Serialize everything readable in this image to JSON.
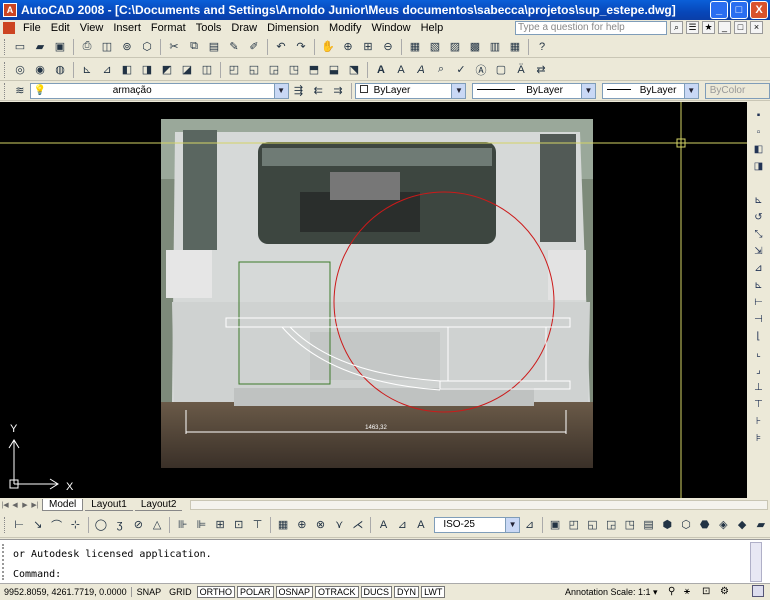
{
  "window": {
    "app_icon": "A",
    "title": "AutoCAD 2008 - [C:\\Documents and Settings\\Arnoldo Junior\\Meus documentos\\sabecca\\projetos\\sup_estepe.dwg]",
    "minimize": "_",
    "maximize": "□",
    "close": "X"
  },
  "menu": {
    "items": [
      "File",
      "Edit",
      "View",
      "Insert",
      "Format",
      "Tools",
      "Draw",
      "Dimension",
      "Modify",
      "Window",
      "Help"
    ],
    "search_placeholder": "Type a question for help"
  },
  "layers": {
    "current_layer": "armação",
    "color": "ByLayer",
    "linetype": "ByLayer",
    "lineweight": "ByLayer",
    "plotstyle": "ByColor"
  },
  "drawing": {
    "dimension_text": "1463,32",
    "ucs_y": "Y",
    "ucs_x": "X",
    "colors": {
      "background": "#000000",
      "circle": "#cc1a1a",
      "rect": "#3c7a2a",
      "crosshair": "#d4d466"
    }
  },
  "tabs": [
    "Model",
    "Layout1",
    "Layout2"
  ],
  "dim_style": "ISO-25",
  "command": {
    "history": "or Autodesk licensed application.",
    "prompt": "Command:"
  },
  "status": {
    "coords": "9952.8059, 4261.7719, 0.0000",
    "toggles": [
      {
        "label": "SNAP",
        "on": false
      },
      {
        "label": "GRID",
        "on": false
      },
      {
        "label": "ORTHO",
        "on": true
      },
      {
        "label": "POLAR",
        "on": true
      },
      {
        "label": "OSNAP",
        "on": true
      },
      {
        "label": "OTRACK",
        "on": true
      },
      {
        "label": "DUCS",
        "on": true
      },
      {
        "label": "DYN",
        "on": true
      },
      {
        "label": "LWT",
        "on": true
      }
    ],
    "annotation_scale": "Annotation Scale:  1:1 ▾"
  }
}
